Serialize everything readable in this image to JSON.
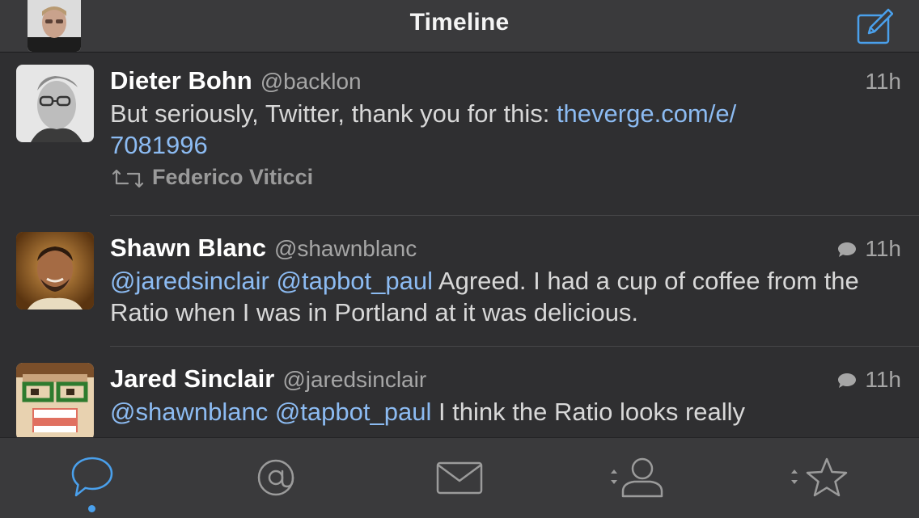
{
  "header": {
    "title": "Timeline",
    "avatar_icon": "user-avatar",
    "compose_icon": "compose-icon"
  },
  "colors": {
    "accent": "#4aa0ec",
    "link": "#8cbbf2",
    "background": "#2f2f31",
    "bar": "#3a3a3c"
  },
  "tweets": [
    {
      "name": "Dieter Bohn",
      "handle": "@backlon",
      "time": "11h",
      "text_prefix": "But seriously, Twitter, thank you for this: ",
      "link_line1": "theverge.com/e/",
      "link_line2": "7081996",
      "retweeted_by": "Federico Viticci"
    },
    {
      "name": "Shawn Blanc",
      "handle": "@shawnblanc",
      "time": "11h",
      "mention1": "@jaredsinclair",
      "mention2": "@tapbot_paul",
      "text": " Agreed. I had a cup of coffee from the Ratio when I was in Portland at it was delicious."
    },
    {
      "name": "Jared Sinclair",
      "handle": "@jaredsinclair",
      "time": "11h",
      "mention1": "@shawnblanc",
      "mention2": "@tapbot_paul",
      "text": " I think the Ratio looks really"
    }
  ],
  "tabs": [
    {
      "name": "timeline",
      "icon": "speech-bubble-icon",
      "active": true
    },
    {
      "name": "mentions",
      "icon": "at-sign-icon"
    },
    {
      "name": "messages",
      "icon": "envelope-icon"
    },
    {
      "name": "profile",
      "icon": "person-icon"
    },
    {
      "name": "favorites",
      "icon": "star-icon"
    }
  ]
}
